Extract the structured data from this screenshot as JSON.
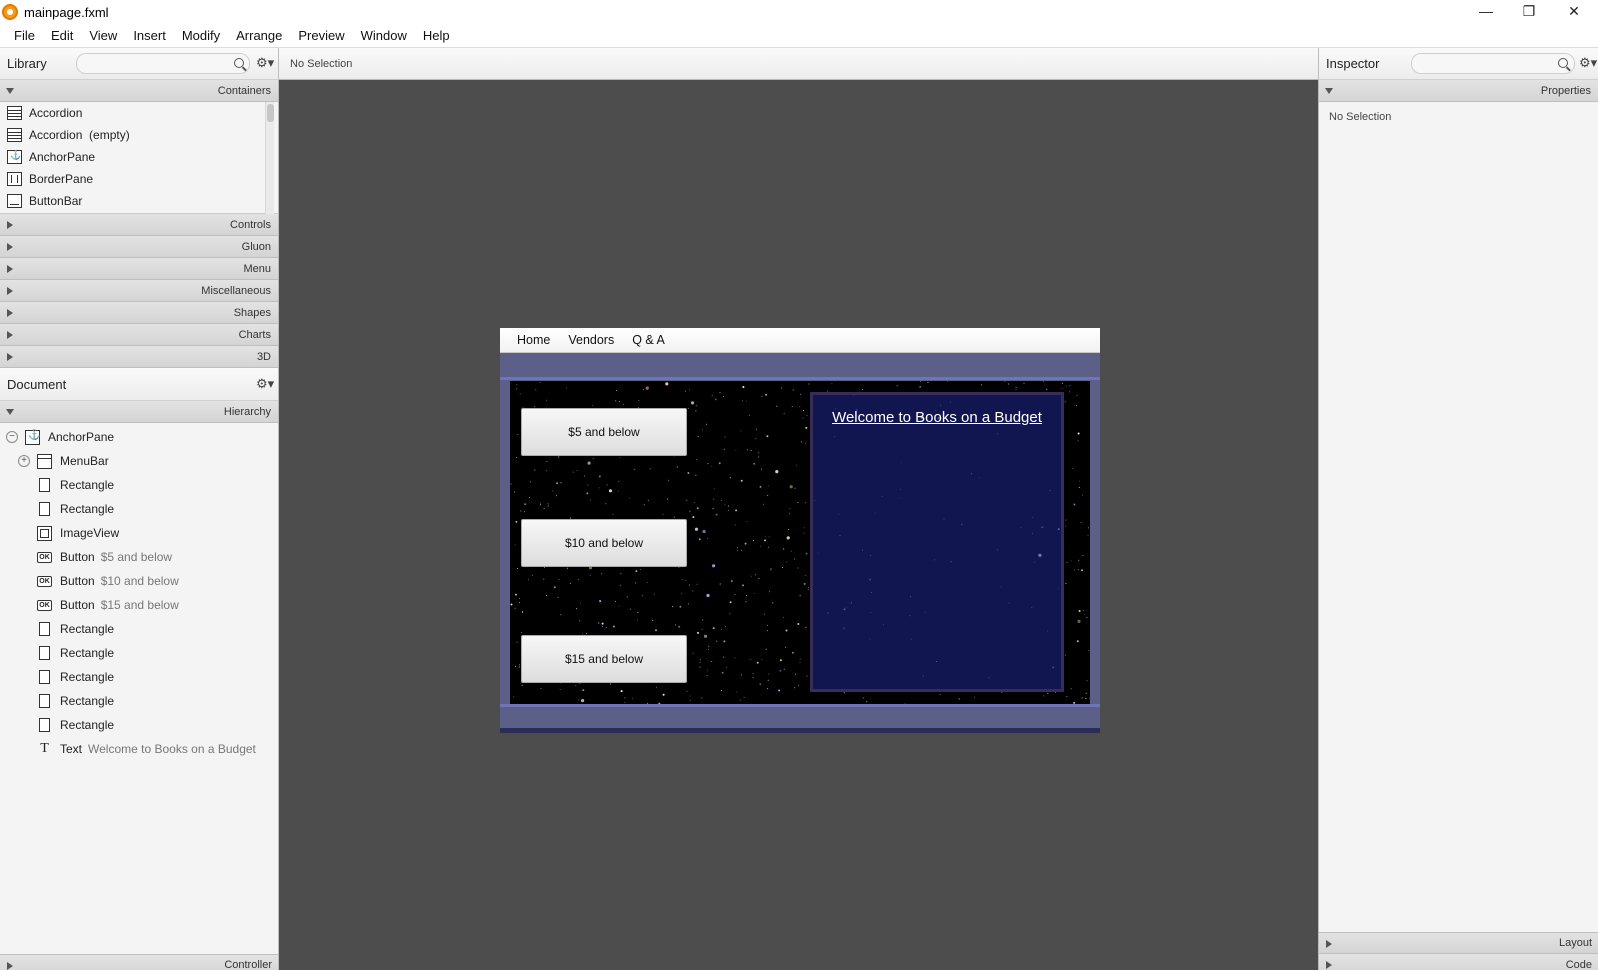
{
  "window": {
    "title": "mainpage.fxml",
    "minimize": "—",
    "restore": "❐",
    "close": "✕"
  },
  "menubar": [
    "File",
    "Edit",
    "View",
    "Insert",
    "Modify",
    "Arrange",
    "Preview",
    "Window",
    "Help"
  ],
  "library": {
    "title": "Library",
    "containers_label": "Containers",
    "items": [
      "Accordion",
      "Accordion  (empty)",
      "AnchorPane",
      "BorderPane",
      "ButtonBar"
    ],
    "sections": [
      "Controls",
      "Gluon",
      "Menu",
      "Miscellaneous",
      "Shapes",
      "Charts",
      "3D"
    ]
  },
  "document": {
    "title": "Document",
    "hierarchy_label": "Hierarchy",
    "tree": [
      {
        "type": "AnchorPane",
        "sub": ""
      },
      {
        "type": "MenuBar",
        "sub": ""
      },
      {
        "type": "Rectangle",
        "sub": ""
      },
      {
        "type": "Rectangle",
        "sub": ""
      },
      {
        "type": "ImageView",
        "sub": ""
      },
      {
        "type": "Button",
        "sub": "$5 and below"
      },
      {
        "type": "Button",
        "sub": "$10 and below"
      },
      {
        "type": "Button",
        "sub": "$15 and below"
      },
      {
        "type": "Rectangle",
        "sub": ""
      },
      {
        "type": "Rectangle",
        "sub": ""
      },
      {
        "type": "Rectangle",
        "sub": ""
      },
      {
        "type": "Rectangle",
        "sub": ""
      },
      {
        "type": "Rectangle",
        "sub": ""
      },
      {
        "type": "Text",
        "sub": "Welcome to Books on a Budget"
      }
    ],
    "controller_label": "Controller"
  },
  "canvas": {
    "selection": "No Selection"
  },
  "inspector": {
    "title": "Inspector",
    "properties_label": "Properties",
    "no_selection": "No Selection",
    "layout_label": "Layout",
    "code_label": "Code"
  },
  "preview": {
    "menus": [
      "Home",
      "Vendors",
      "Q & A"
    ],
    "buttons": [
      "$5 and below",
      "$10 and below",
      "$15 and below"
    ],
    "welcome": "Welcome to Books on a Budget"
  },
  "colors": {
    "canvas": "#4d4d4d",
    "form_band": "#5c6088",
    "welcome_box": "#121650"
  },
  "icons": [
    "search-icon",
    "gear-icon",
    "anchor-icon",
    "ok-button-icon",
    "text-icon"
  ]
}
